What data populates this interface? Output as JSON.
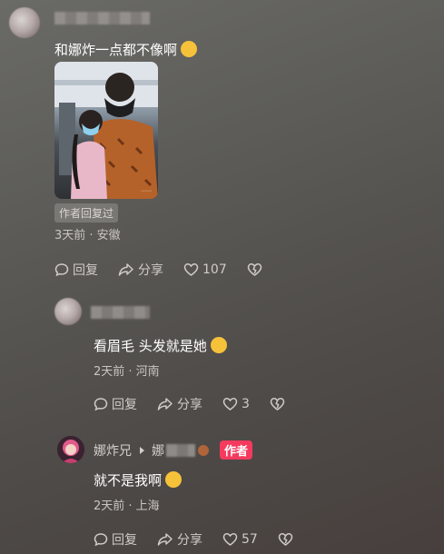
{
  "comments": [
    {
      "text": "和娜炸一点都不像啊",
      "badge": "作者回复过",
      "meta": "3天前 · 安徽",
      "actions": {
        "reply": "回复",
        "share": "分享",
        "likes": "107"
      }
    },
    {
      "text": "看眉毛 头发就是她",
      "meta": "2天前 · 河南",
      "actions": {
        "reply": "回复",
        "share": "分享",
        "likes": "3"
      }
    },
    {
      "name": "娜炸兄",
      "reply_to_first_char": "娜",
      "author_badge": "作者",
      "text": "就不是我啊",
      "meta": "2天前 · 上海",
      "actions": {
        "reply": "回复",
        "share": "分享",
        "likes": "57"
      }
    }
  ],
  "colors": {
    "author_badge": "#f53a5e",
    "emoji": "#f6c23a"
  }
}
